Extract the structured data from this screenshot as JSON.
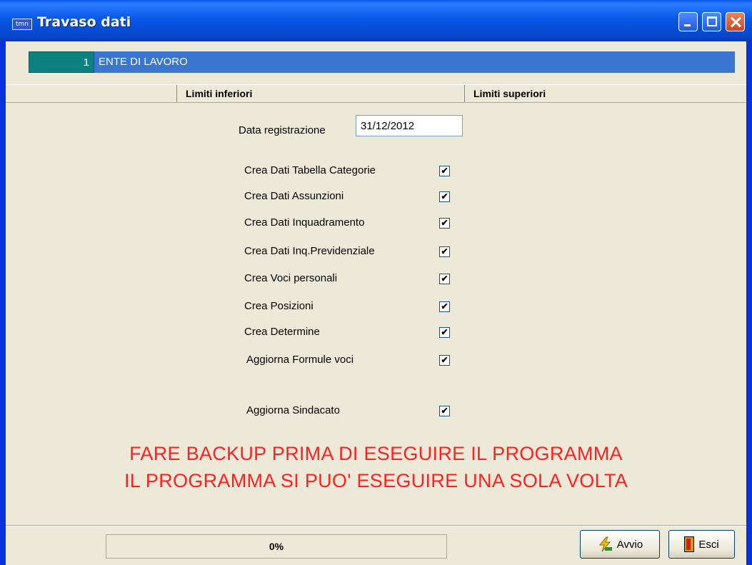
{
  "window": {
    "title": "Travaso dati",
    "icon": "app-icon"
  },
  "header_bar": {
    "code": "1",
    "ente": "ENTE DI LAVORO"
  },
  "columns": {
    "lower": "Limiti inferiori",
    "upper": "Limiti superiori"
  },
  "date": {
    "label": "Data registrazione",
    "value": "31/12/2012"
  },
  "options": [
    {
      "label": "Crea Dati Tabella Categorie",
      "checked": true
    },
    {
      "label": "Crea Dati Assunzioni",
      "checked": true
    },
    {
      "label": "Crea Dati Inquadramento",
      "checked": true
    },
    {
      "label": "Crea Dati Inq.Previdenziale",
      "checked": true
    },
    {
      "label": "Crea Voci personali",
      "checked": true
    },
    {
      "label": "Crea Posizioni",
      "checked": true
    },
    {
      "label": "Crea Determine",
      "checked": true
    },
    {
      "label": "Aggiorna Formule voci",
      "checked": true
    },
    {
      "label": "Aggiorna Sindacato",
      "checked": true
    }
  ],
  "warnings": [
    "FARE BACKUP PRIMA DI ESEGUIRE IL PROGRAMMA",
    "IL PROGRAMMA SI PUO' ESEGUIRE UNA SOLA VOLTA"
  ],
  "progress": {
    "text": "0%",
    "value": 0
  },
  "buttons": {
    "start": "Avvio",
    "exit": "Esci"
  },
  "colors": {
    "title_bar": "#0A59F0",
    "code_box": "#0E8080",
    "ente_bar": "#3A75CF",
    "warning": "#FF2020"
  }
}
